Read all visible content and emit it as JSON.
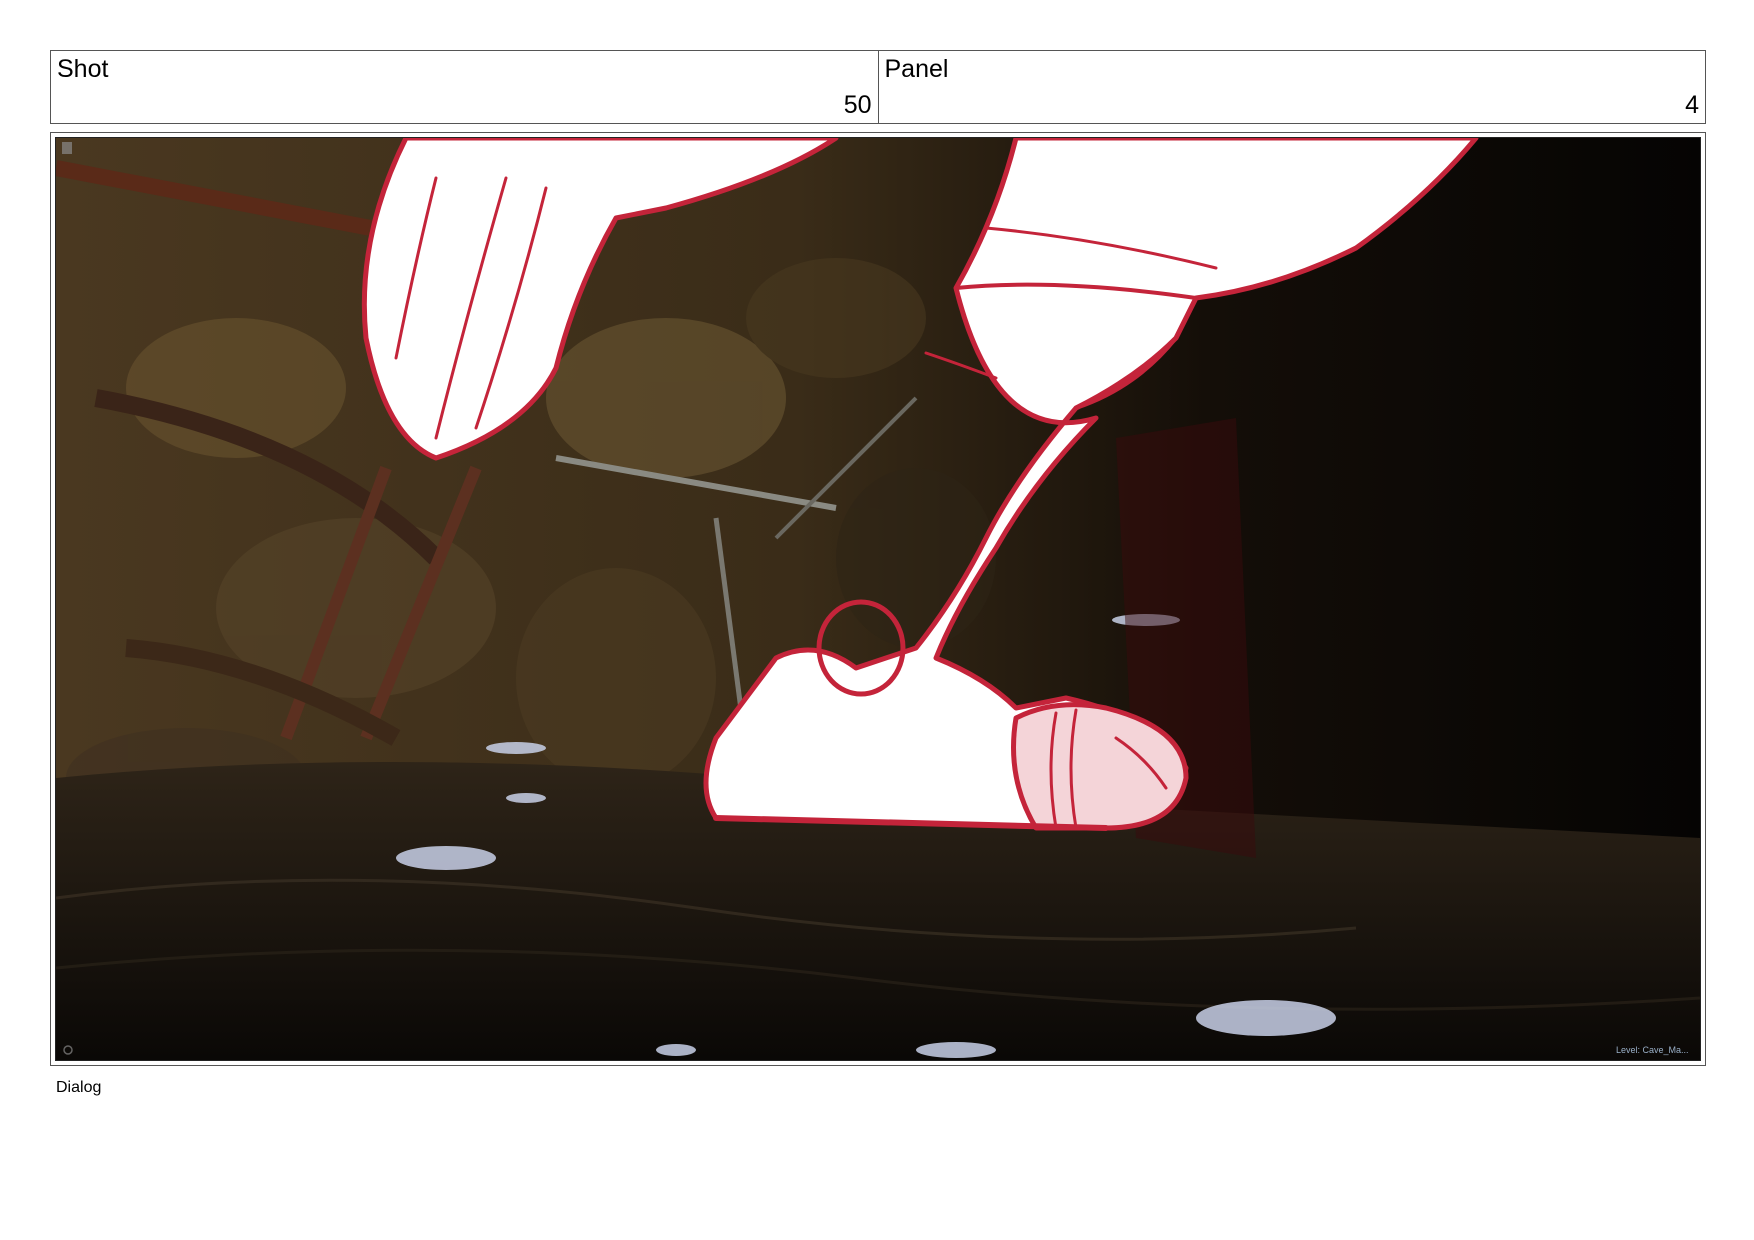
{
  "header": {
    "shot_label": "Shot",
    "shot_number": "50",
    "panel_label": "Panel",
    "panel_number": "4"
  },
  "viewport": {
    "level_text": "Level:  Cave_Ma..."
  },
  "dialog": {
    "label": "Dialog"
  },
  "colors": {
    "sketch_line": "#c4243a",
    "sketch_fill": "#ffffff",
    "cave_dark": "#0b0806",
    "cave_rock": "#5a4628"
  }
}
